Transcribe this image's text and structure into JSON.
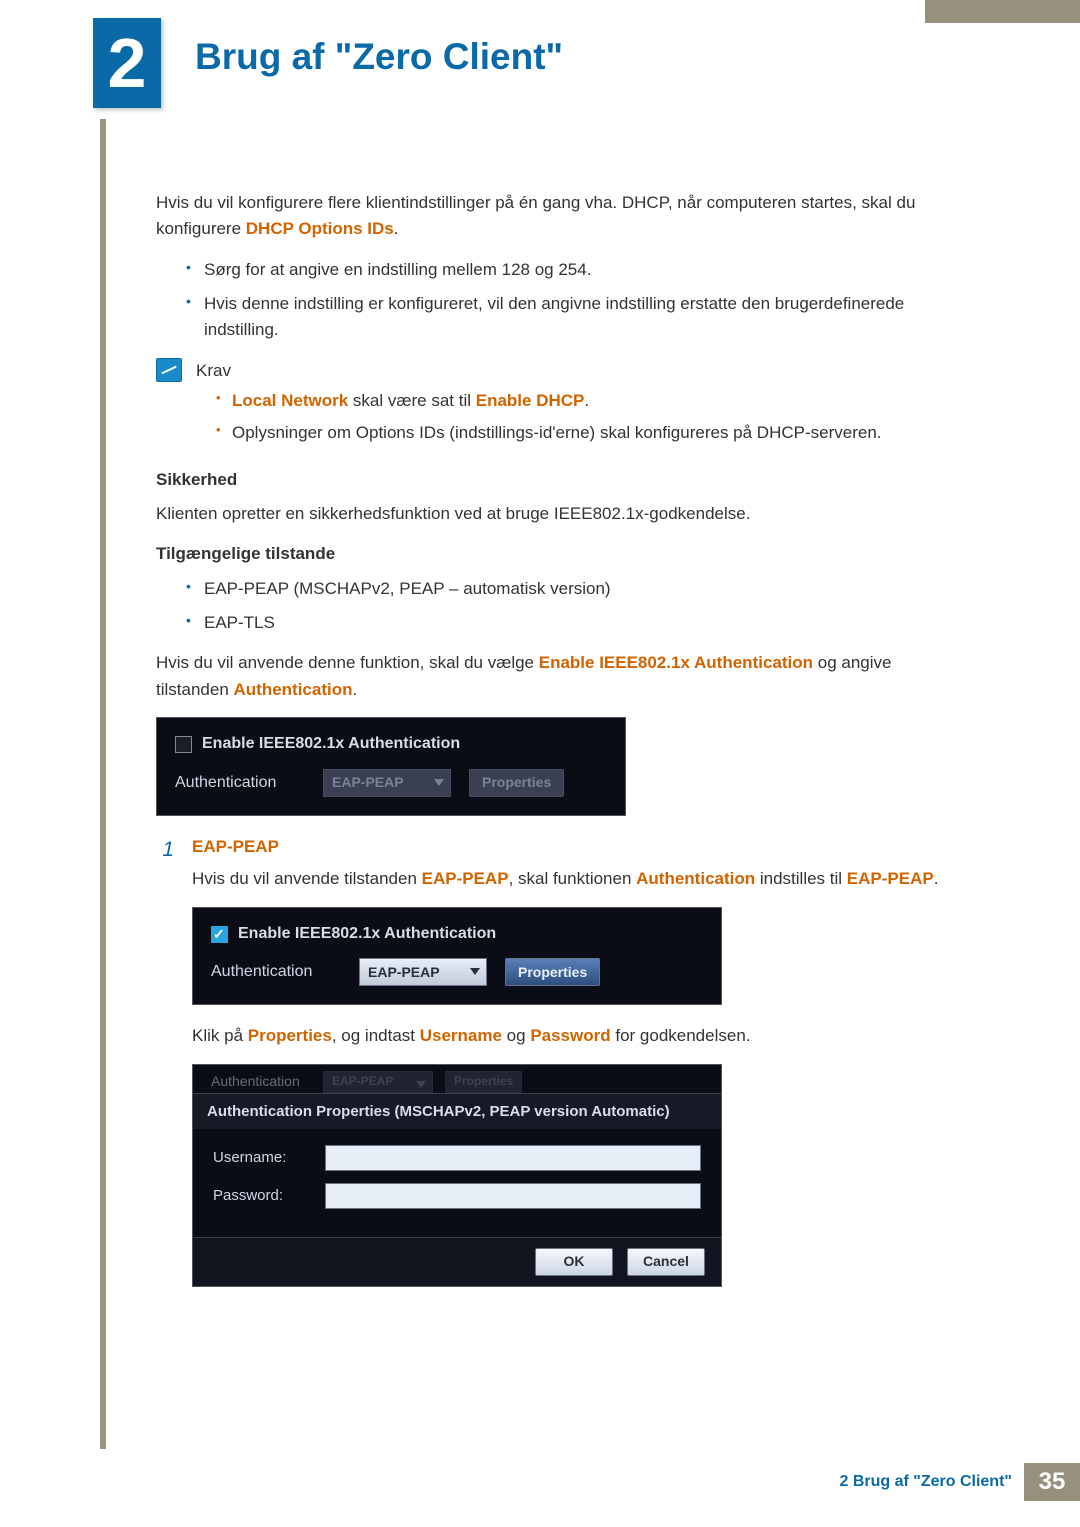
{
  "chapter": {
    "number": "2",
    "title": "Brug af \"Zero Client\""
  },
  "intro": {
    "prefix": "Hvis du vil konfigurere flere klientindstillinger på én gang vha. DHCP, når computeren startes, skal du konfigurere ",
    "hl": "DHCP Options IDs",
    "suffix": "."
  },
  "bullets1": [
    "Sørg for at angive en indstilling mellem 128 og 254.",
    "Hvis denne indstilling er konfigureret, vil den angivne indstilling erstatte den brugerdefinerede indstilling."
  ],
  "note": {
    "heading": "Krav",
    "item1_hl1": "Local Network",
    "item1_mid": " skal være sat til ",
    "item1_hl2": "Enable DHCP",
    "item1_end": ".",
    "item2": "Oplysninger om Options IDs (indstillings-id'erne) skal konfigureres på DHCP-serveren."
  },
  "sikkerhed": {
    "heading": "Sikkerhed",
    "body": "Klienten opretter en sikkerhedsfunktion ved at bruge IEEE802.1x-godkendelse."
  },
  "modes": {
    "heading": "Tilgængelige tilstande",
    "items": [
      "EAP-PEAP (MSCHAPv2, PEAP – automatisk version)",
      "EAP-TLS"
    ]
  },
  "enable_line": {
    "prefix": "Hvis du vil anvende denne funktion, skal du vælge ",
    "hl1": "Enable IEEE802.1x Authentication",
    "mid": " og angive tilstanden ",
    "hl2": "Authentication",
    "suffix": "."
  },
  "panel1": {
    "chk_label": "Enable IEEE802.1x Authentication",
    "auth_label": "Authentication",
    "dd_value": "EAP-PEAP",
    "btn": "Properties"
  },
  "step1": {
    "num": "1",
    "title": "EAP-PEAP",
    "line_prefix": "Hvis du vil anvende tilstanden ",
    "hl1": "EAP-PEAP",
    "line_mid1": ", skal funktionen ",
    "hl2": "Authentication",
    "line_mid2": " indstilles til ",
    "hl3": "EAP-PEAP",
    "line_suffix": "."
  },
  "panel2": {
    "chk_label": "Enable IEEE802.1x Authentication",
    "auth_label": "Authentication",
    "dd_value": "EAP-PEAP",
    "btn": "Properties"
  },
  "props_line": {
    "prefix": "Klik på ",
    "hl1": "Properties",
    "mid1": ", og indtast ",
    "hl2": "Username",
    "mid2": " og ",
    "hl3": "Password",
    "suffix": " for godkendelsen."
  },
  "dialog": {
    "ghost_label": "Authentication",
    "ghost_dd": "EAP-PEAP",
    "ghost_btn": "Properties",
    "title": "Authentication Properties (MSCHAPv2, PEAP version Automatic)",
    "username_label": "Username:",
    "username_value": "",
    "password_label": "Password:",
    "password_value": "",
    "ok": "OK",
    "cancel": "Cancel"
  },
  "footer": {
    "text": "2 Brug af \"Zero Client\"",
    "page": "35"
  }
}
